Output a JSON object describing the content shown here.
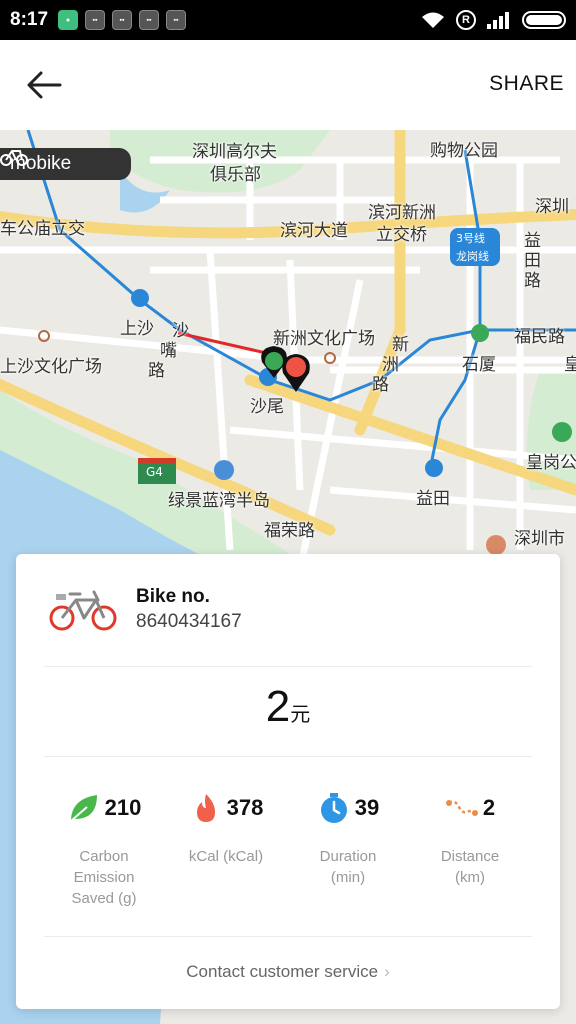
{
  "status_bar": {
    "time": "8:17"
  },
  "header": {
    "share_label": "SHARE"
  },
  "map": {
    "brand_label": "mobike",
    "places": [
      "深圳高尔夫",
      "俱乐部",
      "购物公园",
      "深圳",
      "车公庙立交",
      "滨河大道",
      "滨河新洲",
      "立交桥",
      "益",
      "田",
      "路",
      "上沙",
      "新洲文化广场",
      "福民路",
      "石厦",
      "皇",
      "上沙文化广场",
      "沙尾",
      "新",
      "洲",
      "路",
      "沙",
      "嘴",
      "路",
      "皇岗公",
      "绿景蓝湾半岛",
      "益田",
      "福荣路",
      "深圳市",
      "G4",
      "3号线",
      "龙岗线"
    ],
    "colors": {
      "route_line": "#e4262a",
      "metro_line": "#2a86d6",
      "start_pin": "#3aa857",
      "end_pin": "#ee5344"
    }
  },
  "ride": {
    "bike_label": "Bike no.",
    "bike_number": "8640434167",
    "price_value": "2",
    "price_unit": "元",
    "stats": [
      {
        "icon": "leaf-icon",
        "value": "210",
        "label": "Carbon Emission Saved (g)",
        "color": "#49b84c"
      },
      {
        "icon": "flame-icon",
        "value": "378",
        "label": "kCal (kCal)",
        "color": "#f0614c"
      },
      {
        "icon": "stopwatch-icon",
        "value": "39",
        "label": "Duration (min)",
        "color": "#2f96e4"
      },
      {
        "icon": "route-icon",
        "value": "2",
        "label": "Distance (km)",
        "color": "#f08a46"
      }
    ],
    "contact_label": "Contact customer service"
  }
}
